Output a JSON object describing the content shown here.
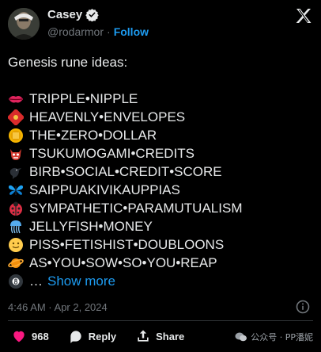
{
  "author": {
    "name": "Casey",
    "handle": "@rodarmor",
    "separator": "·",
    "follow_label": "Follow"
  },
  "tweet": {
    "intro": "Genesis rune ideas:",
    "runes": [
      {
        "icon": "lips-icon",
        "text": "TRIPPLE•NIPPLE"
      },
      {
        "icon": "red-envelope-icon",
        "text": "HEAVENLY•ENVELOPES"
      },
      {
        "icon": "coin-icon",
        "text": "THE•ZERO•DOLLAR"
      },
      {
        "icon": "ogre-icon",
        "text": "TSUKUMOGAMI•CREDITS"
      },
      {
        "icon": "crow-icon",
        "text": "BIRB•SOCIAL•CREDIT•SCORE"
      },
      {
        "icon": "butterfly-icon",
        "text": "SAIPPUAKIVIKAUPPIAS"
      },
      {
        "icon": "ladybug-icon",
        "text": "SYMPATHETIC•PARAMUTUALISM"
      },
      {
        "icon": "jellyfish-icon",
        "text": "JELLYFISH•MONEY"
      },
      {
        "icon": "smiley-icon",
        "text": "PISS•FETISHIST•DOUBLOONS"
      },
      {
        "icon": "planet-icon",
        "text": "AS•YOU•SOW•SO•YOU•REAP"
      }
    ],
    "last_icon": "eight-ball-icon",
    "last_line": "…",
    "show_more": "Show more",
    "timestamp": "4:46 AM · Apr 2, 2024"
  },
  "actions": {
    "like_count": "968",
    "reply_label": "Reply",
    "share_label": "Share"
  },
  "watermark": {
    "text": "公众号 · PP潘妮"
  },
  "colors": {
    "background": "#000000",
    "text": "#e7e9ea",
    "muted": "#71767b",
    "link": "#1d9bf0",
    "like": "#f91880",
    "divider": "#2f3336"
  }
}
